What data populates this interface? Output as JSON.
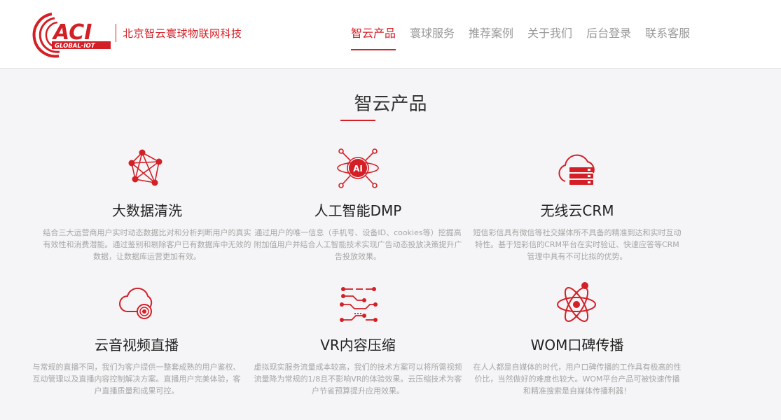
{
  "header": {
    "logo_text": "ACI",
    "logo_subtext": "GLOBAL-IOT",
    "company_name": "北京智云寰球物联网科技",
    "nav": [
      {
        "label": "智云产品",
        "active": true
      },
      {
        "label": "寰球服务",
        "active": false
      },
      {
        "label": "推荐案例",
        "active": false
      },
      {
        "label": "关于我们",
        "active": false
      },
      {
        "label": "后台登录",
        "active": false
      },
      {
        "label": "联系客服",
        "active": false
      }
    ]
  },
  "section": {
    "title": "智云产品"
  },
  "products": [
    {
      "icon": "network-nodes-icon",
      "name": "大数据清洗",
      "desc": "结合三大运营商用户实时动态数据比对和分析判断用户的真实有效性和消费潜能。通过鉴别和剔除客户已有数据库中无效的数据，让数据库运营更加有效。"
    },
    {
      "icon": "ai-chip-icon",
      "name": "人工智能DMP",
      "desc": "通过用户的唯一信息（手机号、设备ID、cookies等）挖掘高附加值用户并结合人工智能技术实现广告动态投放决策提升广告投放效果。"
    },
    {
      "icon": "cloud-server-icon",
      "name": "无线云CRM",
      "desc": "短信彩信具有微信等社交媒体所不具备的精准到达和实时互动特性。基于短彩信的CRM平台在实时验证、快速应答等CRM管理中具有不可比拟的优势。"
    },
    {
      "icon": "cloud-broadcast-icon",
      "name": "云音视频直播",
      "desc": "与常规的直播不同，我们为客户提供一整套成熟的用户鉴权、互动管理以及直播内容控制解决方案。直播用户完美体验，客户直播质量和成果可控。"
    },
    {
      "icon": "circuit-icon",
      "name": "VR内容压缩",
      "desc": "虚拟现实服务流量成本较高，我们的技术方案可以将所需视频流量降为常规的1/8且不影响VR的体验效果。云压缩技术为客户节省预算提升应用效果。"
    },
    {
      "icon": "atom-icon",
      "name": "WOM口碑传播",
      "desc": "在人人都是自媒体的时代，用户口碑传播的工作具有极高的性价比，当然做好的难度也较大。WOM平台产品可被快速传播和精准搜索是自媒体传播利器！"
    }
  ],
  "colors": {
    "accent": "#d41f26",
    "text": "#222222",
    "muted": "#a6a6a6",
    "background": "#f5f5f7"
  }
}
